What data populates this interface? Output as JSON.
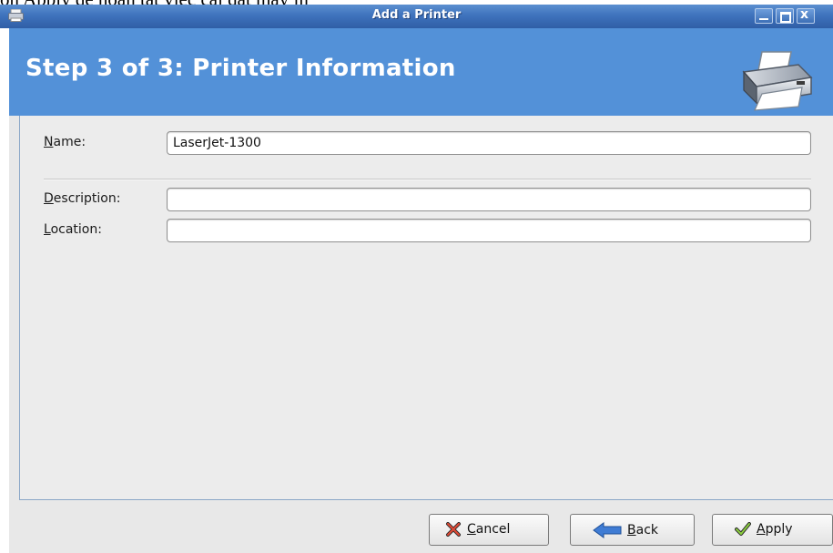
{
  "document": {
    "caption_text": "ọn Apply để hoàn tất việc cài đặt máy in"
  },
  "window": {
    "title": "Add a Printer",
    "icons": {
      "app": "printer-icon",
      "minimize": "minimize-icon",
      "maximize": "maximize-icon",
      "close": "close-icon"
    },
    "close_glyph": "x"
  },
  "header": {
    "step_title": "Step 3 of 3: Printer Information",
    "icon": "printer-icon",
    "background": "#5391d8"
  },
  "form": {
    "name": {
      "mnemonic": "N",
      "label_rest": "ame:",
      "value": "LaserJet-1300"
    },
    "description": {
      "mnemonic": "D",
      "label_rest": "escription:",
      "value": ""
    },
    "location": {
      "mnemonic": "L",
      "label_rest": "ocation:",
      "value": ""
    }
  },
  "buttons": {
    "cancel": {
      "mnemonic": "C",
      "label_rest": "ancel",
      "icon": "cancel-x-icon"
    },
    "back": {
      "mnemonic": "B",
      "label_rest": "ack",
      "icon": "back-arrow-icon"
    },
    "apply": {
      "mnemonic": "A",
      "label_rest": "pply",
      "icon": "checkmark-icon"
    }
  }
}
